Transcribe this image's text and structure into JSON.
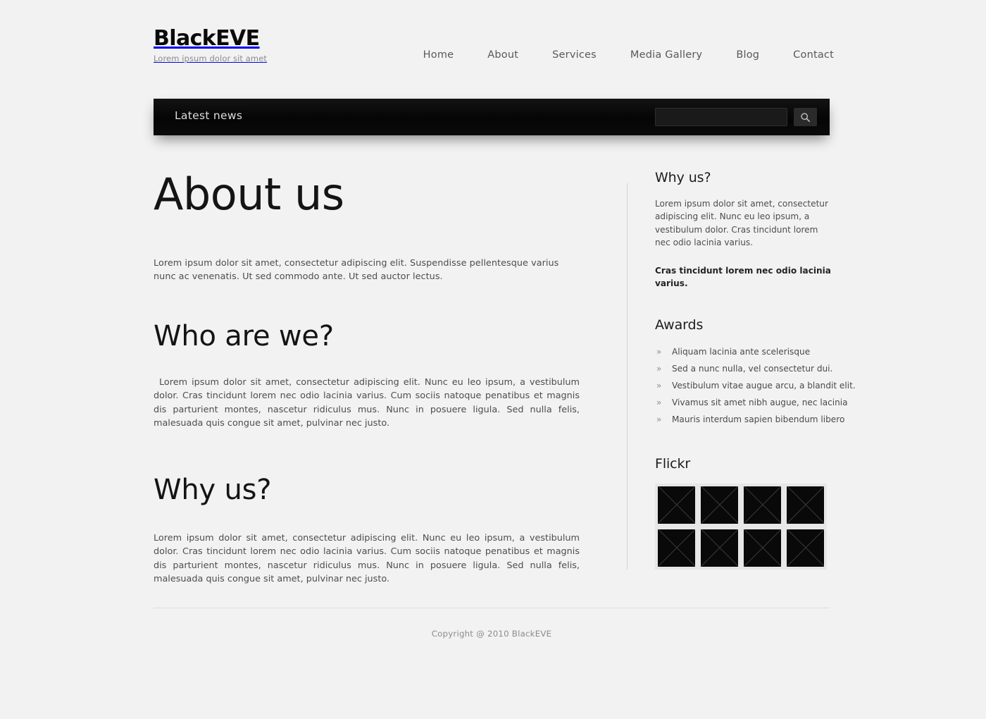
{
  "site": {
    "brand_name": "BlackEVE",
    "brand_tagline": "Lorem ipsum dolor sit amet",
    "background_color": "#f2f2f2",
    "accent_color": "#0a0a0a"
  },
  "nav": {
    "items": [
      {
        "label": "Home"
      },
      {
        "label": "About"
      },
      {
        "label": "Services"
      },
      {
        "label": "Media Gallery"
      },
      {
        "label": "Blog"
      },
      {
        "label": "Contact"
      }
    ]
  },
  "newsbar": {
    "title": "Latest news",
    "bar_color": "#090909",
    "search": {
      "value": "",
      "placeholder": "",
      "icon": "search-icon",
      "button_color": "#2b2b2b"
    }
  },
  "main": {
    "page_title": "About us",
    "intro": "Lorem ipsum dolor sit amet, consectetur adipiscing elit. Suspendisse pellentesque varius nunc ac venenatis. Ut sed commodo ante. Ut sed auctor lectus.",
    "sections": [
      {
        "heading": "Who are we?",
        "body": "Lorem ipsum dolor sit amet, consectetur adipiscing elit. Nunc eu leo ipsum, a vestibulum dolor. Cras tincidunt lorem nec odio lacinia varius. Cum sociis natoque penatibus et magnis dis parturient montes, nascetur ridiculus mus. Nunc in posuere ligula. Sed nulla felis, malesuada quis congue sit amet, pulvinar nec justo."
      },
      {
        "heading": "Why us?",
        "body": "Lorem ipsum dolor sit amet, consectetur adipiscing elit. Nunc eu leo ipsum, a vestibulum dolor. Cras tincidunt lorem nec odio lacinia varius. Cum sociis natoque penatibus et magnis dis parturient montes, nascetur ridiculus mus. Nunc in posuere ligula. Sed nulla felis, malesuada quis congue sit amet, pulvinar nec justo."
      }
    ]
  },
  "sidebar": {
    "why_us": {
      "heading": "Why us?",
      "text": "Lorem ipsum dolor sit amet, consectetur adipiscing elit. Nunc eu leo ipsum, a vestibulum dolor. Cras tincidunt lorem nec odio lacinia varius.",
      "highlight": "Cras tincidunt lorem nec odio lacinia varius."
    },
    "awards": {
      "heading": "Awards",
      "bullet": "»",
      "items": [
        {
          "label": "Aliquam lacinia ante scelerisque"
        },
        {
          "label": "Sed a nunc nulla, vel consectetur dui."
        },
        {
          "label": "Vestibulum vitae augue arcu, a blandit elit."
        },
        {
          "label": "Vivamus sit amet nibh augue, nec lacinia"
        },
        {
          "label": "Mauris interdum sapien bibendum libero"
        }
      ]
    },
    "flickr": {
      "heading": "Flickr",
      "thumbnails": [
        {
          "name": "flickr-thumb-1"
        },
        {
          "name": "flickr-thumb-2"
        },
        {
          "name": "flickr-thumb-3"
        },
        {
          "name": "flickr-thumb-4"
        },
        {
          "name": "flickr-thumb-5"
        },
        {
          "name": "flickr-thumb-6"
        },
        {
          "name": "flickr-thumb-7"
        },
        {
          "name": "flickr-thumb-8"
        }
      ]
    }
  },
  "footer": {
    "copyright": "Copyright @ 2010 BlackEVE"
  }
}
